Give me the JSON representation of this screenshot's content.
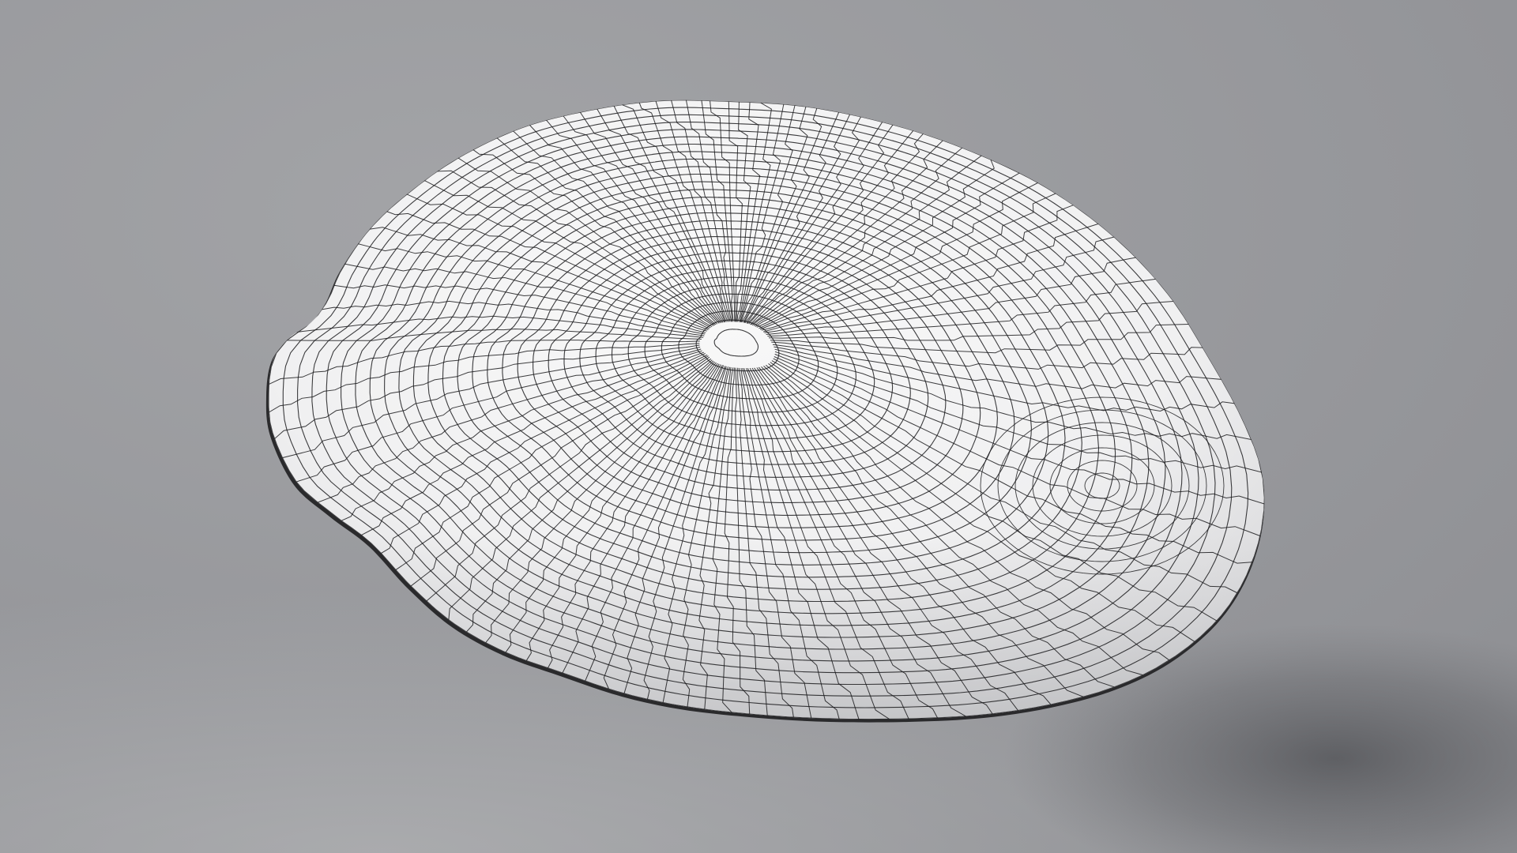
{
  "scene": {
    "subject": "wireframe-mesh-object",
    "colors": {
      "background_top": "#9b9ca0",
      "background_bottom_left": "#a6a7a9",
      "background_bottom_right": "#737478",
      "surface_light": "#f7f7f7",
      "surface_mid": "#e9e9ea",
      "surface_shadow": "#c4c5c7",
      "wire": "#1b1b1d",
      "rim": "#2a2a2c"
    },
    "mesh": {
      "rings": 30,
      "spokes": 112
    }
  }
}
